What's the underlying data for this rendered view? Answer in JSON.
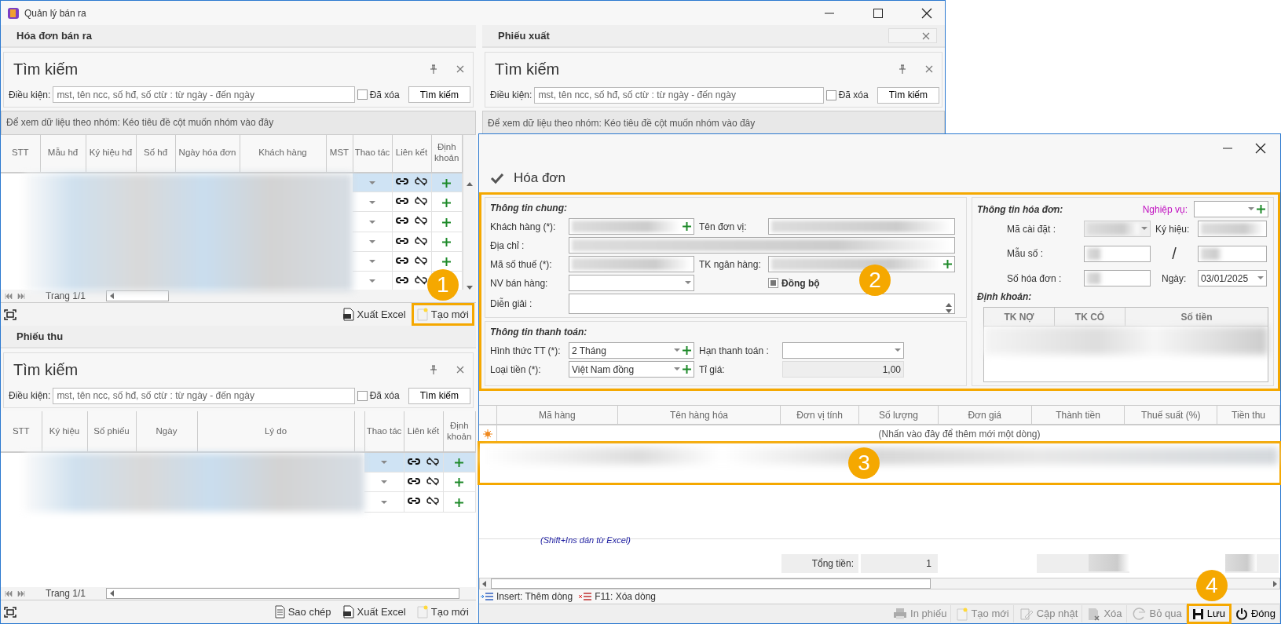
{
  "window": {
    "title": "Quản lý bán ra"
  },
  "left_sections": [
    {
      "title": "Hóa đơn bán ra",
      "closable": false,
      "search": {
        "title": "Tìm kiếm",
        "label": "Điều kiện:",
        "placeholder": "mst, tên ncc, số hđ, số ctừ : từ ngày - đến ngày",
        "deleted_label": "Đã xóa",
        "deleted_checked": false,
        "button": "Tìm kiếm"
      },
      "group_hint": "Để xem dữ liệu theo nhóm: Kéo tiêu đề cột muốn nhóm vào đây",
      "columns": [
        "STT",
        "Mẫu hđ",
        "Ký hiệu hđ",
        "Số hđ",
        "Ngày hóa đơn",
        "Khách hàng",
        "MST"
      ],
      "action_columns": [
        "Thao tác",
        "Liên kết",
        "Định khoản"
      ],
      "rows": [
        {
          "selected": true
        },
        {
          "selected": false
        },
        {
          "selected": false
        },
        {
          "selected": false
        },
        {
          "selected": false
        },
        {
          "selected": false
        }
      ],
      "pager": "Trang 1/1",
      "footer": [
        {
          "kind": "excel",
          "label": "Xuất Excel",
          "highlighted": false
        },
        {
          "kind": "new",
          "label": "Tạo mới",
          "highlighted": true,
          "callout": "1"
        }
      ]
    },
    {
      "title": "Phiếu thu",
      "closable": false,
      "search": {
        "title": "Tìm kiếm",
        "label": "Điều kiện:",
        "placeholder": "mst, tên ncc, số hđ, số ctừ : từ ngày - đến ngày",
        "deleted_label": "Đã xóa",
        "deleted_checked": false,
        "button": "Tìm kiếm"
      },
      "columns": [
        "STT",
        "Ký hiệu",
        "Số phiếu",
        "Ngày",
        "Lý do"
      ],
      "action_columns": [
        "Thao tác",
        "Liên kết",
        "Định khoản"
      ],
      "rows": [
        {
          "selected": true
        },
        {
          "selected": false
        },
        {
          "selected": false
        }
      ],
      "pager": "Trang 1/1",
      "footer": [
        {
          "kind": "copy",
          "label": "Sao chép",
          "highlighted": false
        },
        {
          "kind": "excel",
          "label": "Xuất Excel",
          "highlighted": false
        },
        {
          "kind": "new",
          "label": "Tạo mới",
          "highlighted": false
        }
      ]
    }
  ],
  "right_sections": [
    {
      "title": "Phiếu xuất",
      "closable": true,
      "search": {
        "title": "Tìm kiếm",
        "label": "Điều kiện:",
        "placeholder": "mst, tên ncc, số hđ, số ctừ : từ ngày - đến ngày",
        "deleted_label": "Đã xóa",
        "deleted_checked": false,
        "button": "Tìm kiếm"
      },
      "group_hint": "Để xem dữ liệu theo nhóm: Kéo tiêu đề cột muốn nhóm vào đây"
    }
  ],
  "dialog": {
    "title": "Hóa đơn",
    "form": {
      "highlighted": true,
      "callout": "2",
      "general": {
        "heading": "Thông tin chung:",
        "fields": [
          {
            "kind": "text",
            "label": "Khách hàng (*):",
            "blurred": true,
            "addable": true,
            "wide": false
          },
          {
            "kind": "text",
            "label": "Tên đơn vị:",
            "blurred": true,
            "addable": false,
            "wide": false
          },
          {
            "kind": "text",
            "label": "Địa chỉ :",
            "blurred": true,
            "addable": false,
            "wide": true
          },
          {
            "kind": "text",
            "label": "Mã số thuế (*):",
            "blurred": true,
            "addable": false,
            "wide": false
          },
          {
            "kind": "text",
            "label": "TK ngân hàng:",
            "blurred": true,
            "addable": true,
            "wide": false
          },
          {
            "kind": "dropdown",
            "label": "NV bán hàng:",
            "blurred": false,
            "addable": false,
            "wide": false
          },
          {
            "kind": "checkbox",
            "label": "Đồng bộ",
            "checked": true
          },
          {
            "kind": "memo",
            "label": "Diễn giải :",
            "wide": true
          }
        ]
      },
      "payment": {
        "heading": "Thông tin thanh toán:",
        "fields": [
          {
            "kind": "dropdown",
            "label": "Hình thức TT (*):",
            "value": "2 Tháng",
            "addable": true
          },
          {
            "kind": "dropdown",
            "label": "Hạn thanh toán :",
            "addable": false
          },
          {
            "kind": "dropdown",
            "label": "Loại tiền (*):",
            "value": "Việt Nam đồng",
            "addable": true
          },
          {
            "kind": "readonly",
            "label": "Tỉ giá:",
            "value": "1,00",
            "addable": false
          }
        ]
      },
      "invoice": {
        "heading": "Thông tin hóa đơn:",
        "operation_label": "Nghiệp vụ:",
        "setup_label": "Mã cài đặt :",
        "symbol_label": "Ký hiệu:",
        "form_label": "Mẫu số :",
        "separator": "/",
        "number_label": "Số hóa đơn :",
        "date_label": "Ngày:",
        "date": "03/01/2025",
        "accounting": {
          "heading": "Định khoản:",
          "columns": [
            "TK NỢ",
            "TK CÓ",
            "Số tiền"
          ]
        }
      }
    },
    "grid": {
      "columns": [
        "Mã hàng",
        "Tên hàng hóa",
        "Đơn vị tính",
        "Số lượng",
        "Đơn giá",
        "Thành tiền",
        "Thuế suất (%)",
        "Tiền thu"
      ],
      "new_row_hint": "(Nhấn vào đây để thêm mới một dòng)",
      "row_highlighted": true,
      "row_callout": "3",
      "paste_hint": "(Shift+Ins dán từ Excel)",
      "total_label": "Tổng tiền:",
      "total_value": "1"
    },
    "hints": [
      {
        "kind": "insert",
        "label": "Insert: Thêm dòng"
      },
      {
        "kind": "delete",
        "label": "F11: Xóa dòng"
      }
    ],
    "toolbar": [
      {
        "kind": "print",
        "label": "In phiếu",
        "disabled": true,
        "highlighted": false
      },
      {
        "kind": "new",
        "label": "Tạo mới",
        "disabled": true,
        "highlighted": false
      },
      {
        "kind": "edit",
        "label": "Cập nhật",
        "disabled": true,
        "highlighted": false
      },
      {
        "kind": "delete",
        "label": "Xóa",
        "disabled": true,
        "highlighted": false
      },
      {
        "kind": "undo",
        "label": "Bỏ qua",
        "disabled": true,
        "highlighted": false
      },
      {
        "kind": "save",
        "label": "Lưu",
        "disabled": false,
        "highlighted": true,
        "callout": "4"
      },
      {
        "kind": "power",
        "label": "Đóng",
        "disabled": false,
        "highlighted": false
      }
    ]
  }
}
